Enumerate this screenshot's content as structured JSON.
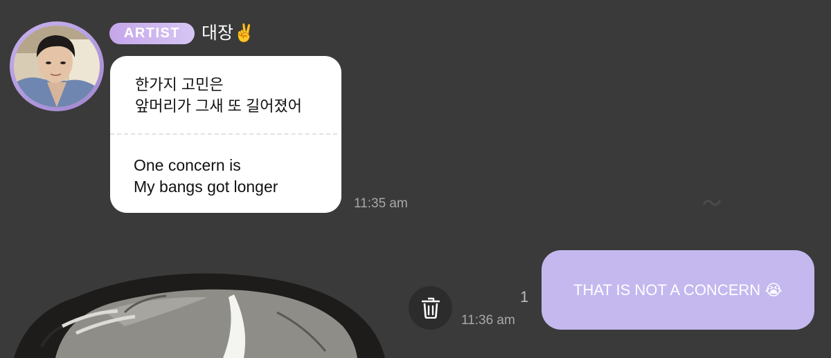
{
  "header": {
    "badge": "ARTIST",
    "sender_name": "대장✌️"
  },
  "messages": {
    "received": {
      "korean_line1": "한가지 고민은",
      "korean_line2": "앞머리가 그새 또 길어졌어",
      "english_line1": "One concern is",
      "english_line2": "My bangs got longer",
      "time": "11:35 am"
    },
    "sent": {
      "text": "THAT IS NOT A CONCERN 😭",
      "time": "11:36 am",
      "unread_count": "1"
    }
  },
  "icons": {
    "delete": "trash-icon",
    "avatar": "artist-avatar"
  },
  "colors": {
    "background": "#3a3a3a",
    "received_bubble": "#ffffff",
    "sent_bubble": "#c4b8ef",
    "badge_start": "#c5a6ea",
    "badge_end": "#d6c6f4",
    "timestamp": "#a8a8a8"
  }
}
